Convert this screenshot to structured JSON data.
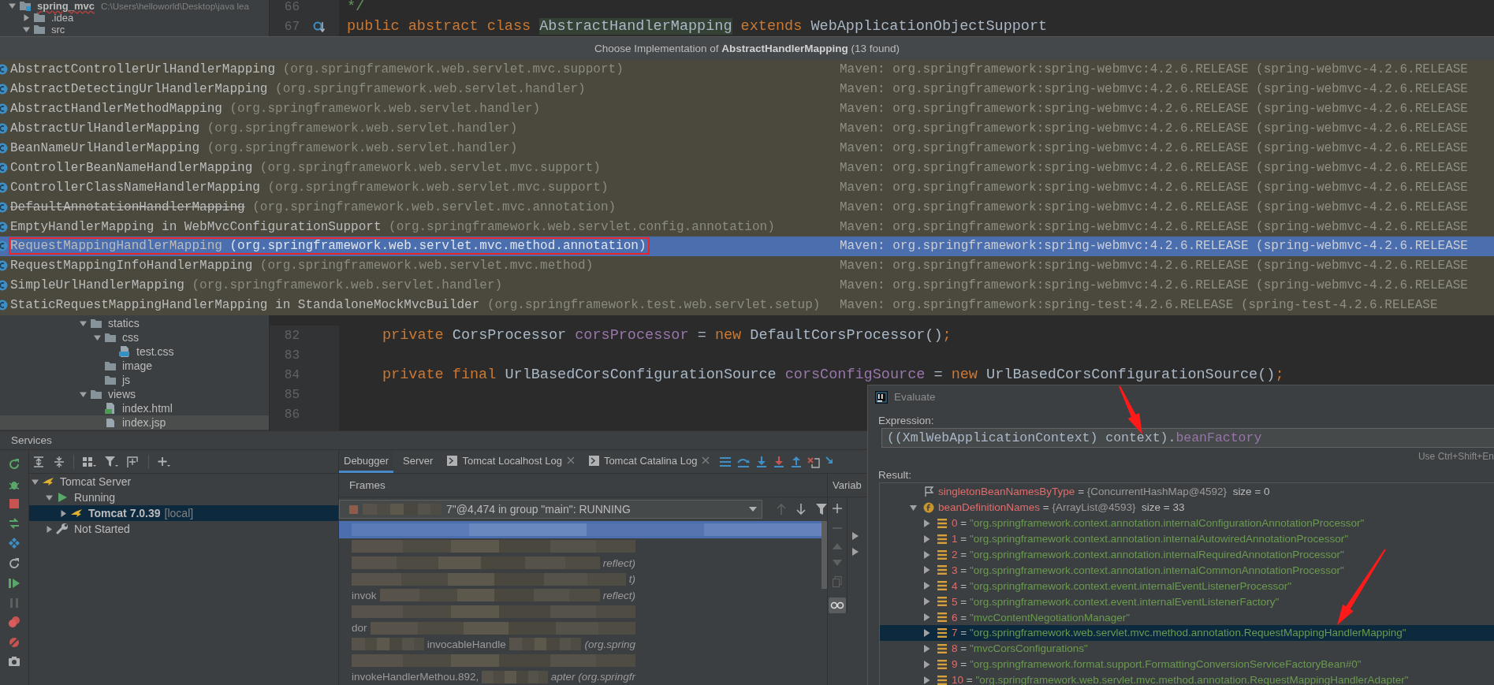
{
  "project_tree_top": [
    {
      "label": "spring_mvc",
      "kind": "module",
      "path": "C:\\Users\\helloworld\\Desktop\\java lea",
      "error": true,
      "expanded": true,
      "children": [
        {
          "label": ".idea",
          "kind": "folder",
          "error": false,
          "expanded": false
        },
        {
          "label": "src",
          "kind": "folder",
          "error": false,
          "expanded": true
        }
      ]
    }
  ],
  "editor_top": [
    {
      "number": "66",
      "marker": false,
      "tokens": [
        {
          "kind": "doc",
          "text": "*/"
        }
      ]
    },
    {
      "number": "67",
      "marker": true,
      "tokens": [
        {
          "kind": "keyword",
          "text": "public abstract class "
        },
        {
          "kind": "highlight",
          "text": "AbstractHandlerMapping"
        },
        {
          "kind": "keyword",
          "text": " extends "
        },
        {
          "kind": "plain",
          "text": "WebApplicationObjectSupport"
        }
      ]
    }
  ],
  "popup": {
    "title": "Choose Implementation of **AbstractHandlerMapping** (13 found)",
    "rows": [
      {
        "name": "AbstractControllerUrlHandlerMapping",
        "package": "(org.springframework.web.servlet.mvc.support)",
        "library": "Maven: org.springframework:spring-webmvc:4.2.6.RELEASE (spring-webmvc-4.2.6.RELEASE",
        "deprecated": false,
        "selected": false,
        "boxed": false
      },
      {
        "name": "AbstractDetectingUrlHandlerMapping",
        "package": "(org.springframework.web.servlet.handler)",
        "library": "Maven: org.springframework:spring-webmvc:4.2.6.RELEASE (spring-webmvc-4.2.6.RELEASE",
        "deprecated": false,
        "selected": false,
        "boxed": false
      },
      {
        "name": "AbstractHandlerMethodMapping",
        "package": "(org.springframework.web.servlet.handler)",
        "library": "Maven: org.springframework:spring-webmvc:4.2.6.RELEASE (spring-webmvc-4.2.6.RELEASE",
        "deprecated": false,
        "selected": false,
        "boxed": false
      },
      {
        "name": "AbstractUrlHandlerMapping",
        "package": "(org.springframework.web.servlet.handler)",
        "library": "Maven: org.springframework:spring-webmvc:4.2.6.RELEASE (spring-webmvc-4.2.6.RELEASE",
        "deprecated": false,
        "selected": false,
        "boxed": false
      },
      {
        "name": "BeanNameUrlHandlerMapping",
        "package": "(org.springframework.web.servlet.handler)",
        "library": "Maven: org.springframework:spring-webmvc:4.2.6.RELEASE (spring-webmvc-4.2.6.RELEASE",
        "deprecated": false,
        "selected": false,
        "boxed": false
      },
      {
        "name": "ControllerBeanNameHandlerMapping",
        "package": "(org.springframework.web.servlet.mvc.support)",
        "library": "Maven: org.springframework:spring-webmvc:4.2.6.RELEASE (spring-webmvc-4.2.6.RELEASE",
        "deprecated": false,
        "selected": false,
        "boxed": false
      },
      {
        "name": "ControllerClassNameHandlerMapping",
        "package": "(org.springframework.web.servlet.mvc.support)",
        "library": "Maven: org.springframework:spring-webmvc:4.2.6.RELEASE (spring-webmvc-4.2.6.RELEASE",
        "deprecated": false,
        "selected": false,
        "boxed": false
      },
      {
        "name": "DefaultAnnotationHandlerMapping",
        "package": "(org.springframework.web.servlet.mvc.annotation)",
        "library": "Maven: org.springframework:spring-webmvc:4.2.6.RELEASE (spring-webmvc-4.2.6.RELEASE",
        "deprecated": true,
        "selected": false,
        "boxed": false
      },
      {
        "name": "EmptyHandlerMapping in WebMvcConfigurationSupport",
        "package": "(org.springframework.web.servlet.config.annotation)",
        "library": "Maven: org.springframework:spring-webmvc:4.2.6.RELEASE (spring-webmvc-4.2.6.RELEASE",
        "deprecated": false,
        "selected": false,
        "boxed": false
      },
      {
        "name": "RequestMappingHandlerMapping",
        "package": "(org.springframework.web.servlet.mvc.method.annotation)",
        "library": "Maven: org.springframework:spring-webmvc:4.2.6.RELEASE (spring-webmvc-4.2.6.RELEASE",
        "deprecated": false,
        "selected": true,
        "boxed": true
      },
      {
        "name": "RequestMappingInfoHandlerMapping",
        "package": "(org.springframework.web.servlet.mvc.method)",
        "library": "Maven: org.springframework:spring-webmvc:4.2.6.RELEASE (spring-webmvc-4.2.6.RELEASE",
        "deprecated": false,
        "selected": false,
        "boxed": false
      },
      {
        "name": "SimpleUrlHandlerMapping",
        "package": "(org.springframework.web.servlet.handler)",
        "library": "Maven: org.springframework:spring-webmvc:4.2.6.RELEASE (spring-webmvc-4.2.6.RELEASE",
        "deprecated": false,
        "selected": false,
        "boxed": false
      },
      {
        "name": "StaticRequestMappingHandlerMapping in StandaloneMockMvcBuilder",
        "package": "(org.springframework.test.web.servlet.setup)",
        "library": "Maven: org.springframework:spring-test:4.2.6.RELEASE (spring-test-4.2.6.RELEASE",
        "deprecated": false,
        "selected": false,
        "boxed": false
      }
    ]
  },
  "project_tree_bottom": [
    {
      "label": "statics",
      "kind": "folder",
      "expanded": true,
      "selected": false,
      "children": [
        {
          "label": "css",
          "kind": "folder",
          "expanded": true,
          "selected": false,
          "children": [
            {
              "label": "test.css",
              "kind": "css_file",
              "selected": false
            }
          ]
        },
        {
          "label": "image",
          "kind": "folder",
          "selected": false
        },
        {
          "label": "js",
          "kind": "folder",
          "selected": false
        }
      ]
    },
    {
      "label": "views",
      "kind": "folder",
      "expanded": true,
      "selected": false,
      "children": [
        {
          "label": "index.html",
          "kind": "html_file",
          "selected": false
        },
        {
          "label": "index.jsp",
          "kind": "jsp_file",
          "selected": true
        }
      ]
    }
  ],
  "editor_bottom": [
    {
      "number": "82",
      "tokens": [
        {
          "kind": "keyword",
          "text": "private"
        },
        {
          "kind": "plain",
          "text": " CorsProcessor "
        },
        {
          "kind": "field",
          "text": "corsProcessor"
        },
        {
          "kind": "plain",
          "text": " = "
        },
        {
          "kind": "keyword",
          "text": "new"
        },
        {
          "kind": "plain",
          "text": " DefaultCorsProcessor()"
        },
        {
          "kind": "keyword",
          "text": ";"
        }
      ]
    },
    {
      "number": "83"
    },
    {
      "number": "84",
      "tokens": [
        {
          "kind": "keyword",
          "text": "private final"
        },
        {
          "kind": "plain",
          "text": " UrlBasedCorsConfigurationSource "
        },
        {
          "kind": "field",
          "text": "corsConfigSource"
        },
        {
          "kind": "plain",
          "text": " = "
        },
        {
          "kind": "keyword",
          "text": "new"
        },
        {
          "kind": "plain",
          "text": " UrlBasedCorsConfigurationSource()"
        },
        {
          "kind": "keyword",
          "text": ";"
        }
      ]
    },
    {
      "number": "85"
    },
    {
      "number": "86"
    }
  ],
  "services": {
    "title": "Services",
    "tree": [
      {
        "label": "Tomcat Server",
        "kind": "server",
        "expanded": true,
        "selected": false,
        "children": [
          {
            "label": "Running",
            "kind": "running",
            "expanded": true,
            "selected": false,
            "children": [
              {
                "label": "Tomcat 7.0.39",
                "note": "[local]",
                "kind": "instance",
                "expanded": false,
                "selected": true
              }
            ]
          },
          {
            "label": "Not Started",
            "kind": "not_started",
            "expanded": false,
            "selected": false
          }
        ]
      }
    ],
    "tabs": [
      {
        "label": "Debugger",
        "selected": true,
        "closable": false,
        "console": false
      },
      {
        "label": "Server",
        "selected": false,
        "closable": false,
        "console": false
      },
      {
        "label": "Tomcat Localhost Log",
        "selected": false,
        "closable": true,
        "console": true
      },
      {
        "label": "Tomcat Catalina Log",
        "selected": false,
        "closable": true,
        "console": true
      }
    ],
    "frames_title": "Frames",
    "variables_title": "Variab",
    "thread": "7\"@4,474 in group \"main\": RUNNING",
    "frames": [
      {
        "selected": true,
        "parts": [
          {
            "kind": "blur"
          }
        ]
      },
      {
        "selected": false,
        "parts": [
          {
            "kind": "blur"
          }
        ]
      },
      {
        "selected": false,
        "parts": [
          {
            "kind": "blur"
          },
          {
            "kind": "text",
            "text": "reflect)",
            "italic": true
          }
        ]
      },
      {
        "selected": false,
        "parts": [
          {
            "kind": "blur"
          },
          {
            "kind": "text",
            "text": "t)",
            "italic": true
          }
        ]
      },
      {
        "selected": false,
        "parts": [
          {
            "kind": "text",
            "text": "invok",
            "italic": false
          },
          {
            "kind": "blur"
          },
          {
            "kind": "text",
            "text": "reflect)",
            "italic": true
          }
        ]
      },
      {
        "selected": false,
        "parts": [
          {
            "kind": "blur"
          }
        ]
      },
      {
        "selected": false,
        "parts": [
          {
            "kind": "text",
            "text": "dor",
            "italic": false
          },
          {
            "kind": "blur"
          }
        ]
      },
      {
        "selected": false,
        "parts": [
          {
            "kind": "blur"
          },
          {
            "kind": "text",
            "text": "invocableHandle",
            "italic": false
          },
          {
            "kind": "blur"
          },
          {
            "kind": "text",
            "text": "(org.spring",
            "italic": true
          }
        ]
      },
      {
        "selected": false,
        "parts": [
          {
            "kind": "blur"
          }
        ]
      },
      {
        "selected": false,
        "parts": [
          {
            "kind": "text",
            "text": "invokeHandlerMethou.892,",
            "italic": false
          },
          {
            "kind": "blur"
          },
          {
            "kind": "text",
            "text": "apter (org.springfr",
            "italic": true
          }
        ]
      }
    ]
  },
  "evaluate": {
    "title": "Evaluate",
    "expression_label": "Expression:",
    "expression": [
      {
        "kind": "plain",
        "text": "((XmlWebApplicationContext) context)."
      },
      {
        "kind": "field",
        "text": "beanFactory"
      }
    ],
    "hint": "Use Ctrl+Shift+En",
    "result_label": "Result:",
    "result": [
      {
        "kind": "flag",
        "name": "singletonBeanNamesByType",
        "eq": "=",
        "type": "{ConcurrentHashMap@4592}",
        "size": "size = 0",
        "selected": false
      },
      {
        "kind": "field",
        "name": "beanDefinitionNames",
        "eq": "=",
        "type": "{ArrayList@4593}",
        "size": "size = 33",
        "expanded": true,
        "selected": false,
        "children": [
          {
            "kind": "element",
            "name": "0",
            "eq": "=",
            "value": "\"org.springframework.context.annotation.internalConfigurationAnnotationProcessor\"",
            "expanded": false,
            "selected": false
          },
          {
            "kind": "element",
            "name": "1",
            "eq": "=",
            "value": "\"org.springframework.context.annotation.internalAutowiredAnnotationProcessor\"",
            "expanded": false,
            "selected": false
          },
          {
            "kind": "element",
            "name": "2",
            "eq": "=",
            "value": "\"org.springframework.context.annotation.internalRequiredAnnotationProcessor\"",
            "expanded": false,
            "selected": false
          },
          {
            "kind": "element",
            "name": "3",
            "eq": "=",
            "value": "\"org.springframework.context.annotation.internalCommonAnnotationProcessor\"",
            "expanded": false,
            "selected": false
          },
          {
            "kind": "element",
            "name": "4",
            "eq": "=",
            "value": "\"org.springframework.context.event.internalEventListenerProcessor\"",
            "expanded": false,
            "selected": false
          },
          {
            "kind": "element",
            "name": "5",
            "eq": "=",
            "value": "\"org.springframework.context.event.internalEventListenerFactory\"",
            "expanded": false,
            "selected": false
          },
          {
            "kind": "element",
            "name": "6",
            "eq": "=",
            "value": "\"mvcContentNegotiationManager\"",
            "expanded": false,
            "selected": false
          },
          {
            "kind": "element",
            "name": "7",
            "eq": "=",
            "value": "\"org.springframework.web.servlet.mvc.method.annotation.RequestMappingHandlerMapping\"",
            "expanded": false,
            "selected": true
          },
          {
            "kind": "element",
            "name": "8",
            "eq": "=",
            "value": "\"mvcCorsConfigurations\"",
            "expanded": false,
            "selected": false
          },
          {
            "kind": "element",
            "name": "9",
            "eq": "=",
            "value": "\"org.springframework.format.support.FormattingConversionServiceFactoryBean#0\"",
            "expanded": false,
            "selected": false
          },
          {
            "kind": "element",
            "name": "10",
            "eq": "=",
            "value": "\"org.springframework.web.servlet.mvc.method.annotation.RequestMappingHandlerAdapter\"",
            "expanded": false,
            "selected": false
          }
        ]
      }
    ]
  }
}
